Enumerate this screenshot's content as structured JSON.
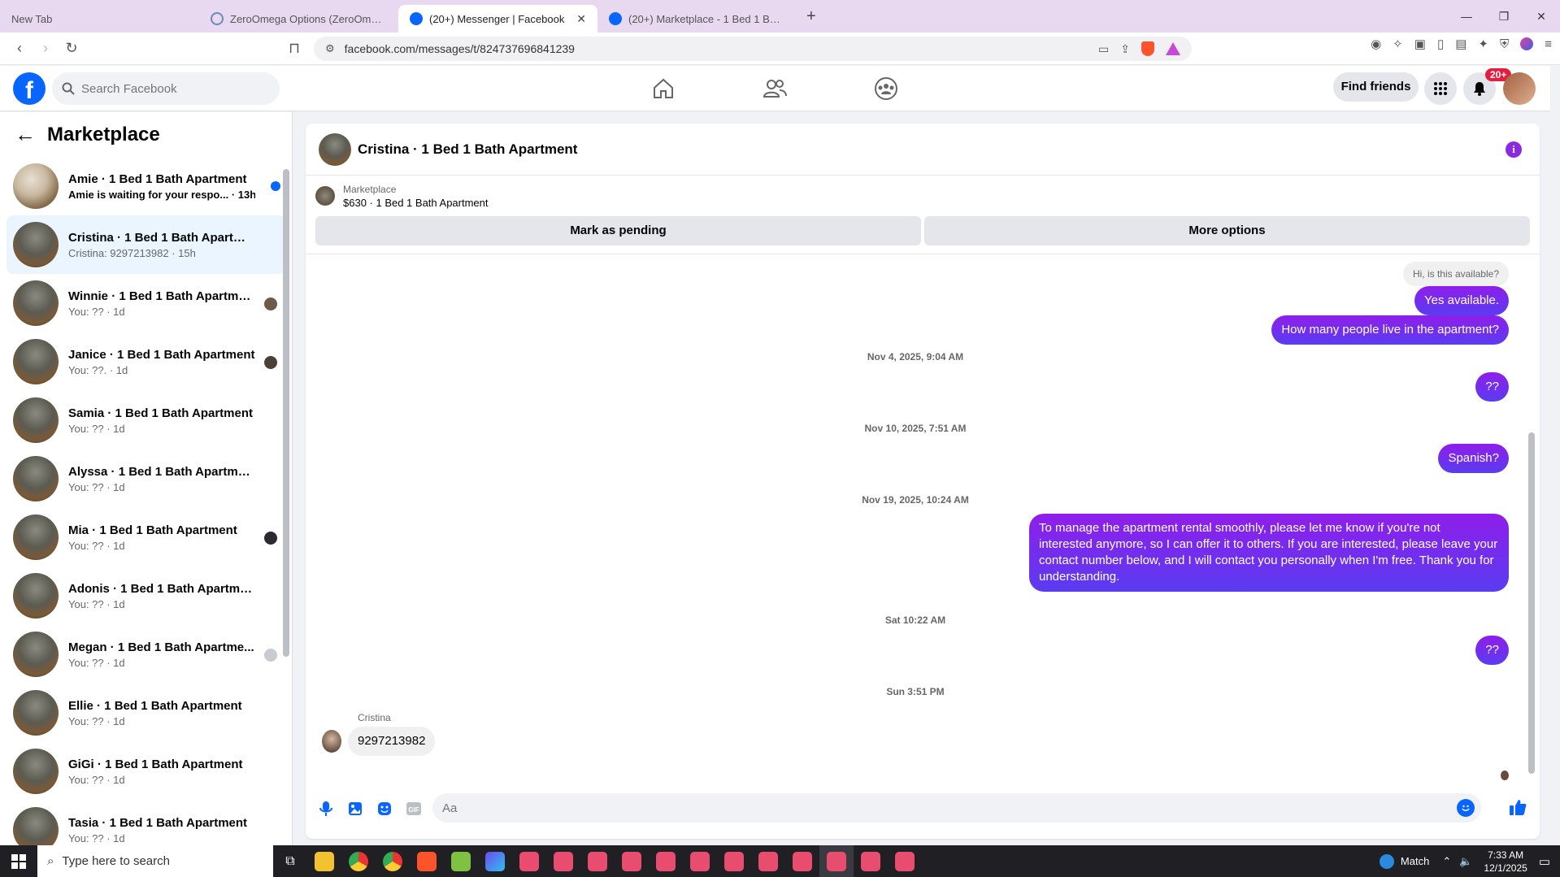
{
  "browser": {
    "tabs": [
      {
        "label": "New Tab"
      },
      {
        "label": "ZeroOmega Options (ZeroOmega)"
      },
      {
        "label": "(20+) Messenger | Facebook"
      },
      {
        "label": "(20+) Marketplace - 1 Bed 1 Bath Apartment"
      }
    ],
    "url": "facebook.com/messages/t/824737696841239"
  },
  "fb": {
    "search_placeholder": "Search Facebook",
    "find_friends": "Find friends",
    "notif_badge": "20+"
  },
  "sidebar": {
    "title": "Marketplace",
    "items": [
      {
        "name": "Amie · 1 Bed 1 Bath Apartment",
        "preview": "Amie is waiting for your respo... · 13h"
      },
      {
        "name": "Cristina · 1 Bed 1 Bath Apartment",
        "preview": "Cristina: 9297213982 · 15h"
      },
      {
        "name": "Winnie · 1 Bed 1 Bath Apartme...",
        "preview": "You: ?? · 1d"
      },
      {
        "name": "Janice · 1 Bed 1 Bath Apartment",
        "preview": "You: ??. · 1d"
      },
      {
        "name": "Samia · 1 Bed 1 Bath Apartment",
        "preview": "You: ?? · 1d"
      },
      {
        "name": "Alyssa · 1 Bed 1 Bath Apartment",
        "preview": "You: ?? · 1d"
      },
      {
        "name": "Mia · 1 Bed 1 Bath Apartment",
        "preview": "You: ?? · 1d"
      },
      {
        "name": "Adonis · 1 Bed 1 Bath Apartment",
        "preview": "You: ?? · 1d"
      },
      {
        "name": "Megan · 1 Bed 1 Bath Apartme...",
        "preview": "You: ?? · 1d"
      },
      {
        "name": "Ellie · 1 Bed 1 Bath Apartment",
        "preview": "You: ?? · 1d"
      },
      {
        "name": "GiGi · 1 Bed 1 Bath Apartment",
        "preview": "You: ?? · 1d"
      },
      {
        "name": "Tasia · 1 Bed 1 Bath Apartment",
        "preview": "You: ?? · 1d"
      }
    ]
  },
  "chat": {
    "title": "Cristina · 1 Bed 1 Bath Apartment",
    "listing_source": "Marketplace",
    "listing_price": "$630 · 1 Bed 1 Bath Apartment",
    "mark_pending": "Mark as pending",
    "more_options": "More options",
    "reply_quote": "Hi, is this available?",
    "msg1": "Yes available.",
    "msg2": "How many people live in the apartment?",
    "ts1": "Nov 4, 2025, 9:04 AM",
    "msg3": "??",
    "ts2": "Nov 10, 2025, 7:51 AM",
    "msg4": "Spanish?",
    "ts3": "Nov 19, 2025, 10:24 AM",
    "msg5_line1": "To manage the apartment rental smoothly, please let me know if you're not",
    "msg5_line2": "interested anymore, so I can offer it to others. If you are interested, please leave your",
    "msg5_line3": "contact number below, and I will contact you personally when I'm free. Thank you for",
    "msg5_line4": "understanding.",
    "ts4": "Sat 10:22 AM",
    "msg6": "??",
    "ts5": "Sun 3:51 PM",
    "sender_name": "Cristina",
    "msg7": "9297213982",
    "composer_placeholder": "Aa"
  },
  "taskbar": {
    "search_placeholder": "Type here to search",
    "weather": "Match",
    "time": "7:33 AM",
    "date": "12/1/2025"
  }
}
